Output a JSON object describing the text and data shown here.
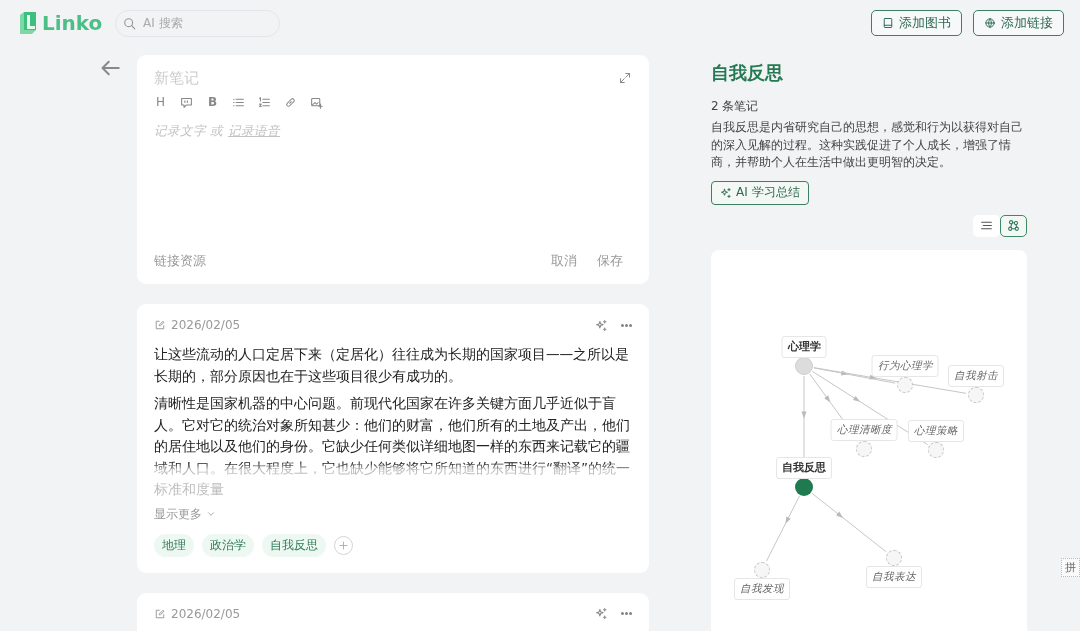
{
  "header": {
    "logo": "Linko",
    "search": {
      "placeholder": "AI 搜索"
    },
    "buttons": [
      {
        "kind": "book",
        "label": "添加图书"
      },
      {
        "kind": "globe",
        "label": "添加链接"
      }
    ]
  },
  "editor": {
    "title_placeholder": "新笔记",
    "toolbar": [
      {
        "kind": "heading",
        "label": "H"
      },
      {
        "kind": "quote"
      },
      {
        "kind": "bold",
        "label": "B"
      },
      {
        "kind": "bullets"
      },
      {
        "kind": "numbers"
      },
      {
        "kind": "link"
      },
      {
        "kind": "image"
      }
    ],
    "placeholder": {
      "text": "记录文字 或",
      "link": "记录语音"
    },
    "link_resource": "链接资源",
    "actions": [
      "取消",
      "保存"
    ]
  },
  "notes": [
    {
      "date": "2026/02/05",
      "paragraphs": [
        "让这些流动的人口定居下来（定居化）往往成为长期的国家项目——之所以是长期的，部分原因也在于这些项目很少有成功的。",
        "清晰性是国家机器的中心问题。前现代化国家在许多关键方面几乎近似于盲人。它对它的统治对象所知甚少：他们的财富，他们所有的土地及产出，他们的居住地以及他们的身份。它缺少任何类似详细地图一样的东西来记载它的疆域和人口。在很大程度上，它也缺少能够将它所知道的东西进行“翻译”的统一标准和度量"
      ],
      "show_more": "显示更多",
      "tags": [
        "地理",
        "政治学",
        "自我反思"
      ]
    },
    {
      "date": "2026/02/05"
    }
  ],
  "topic": {
    "title": "自我反思",
    "count": "2 条笔记",
    "description": "自我反思是内省研究自己的思想，感觉和行为以获得对自己的深入见解的过程。这种实践促进了个人成长，增强了情商，并帮助个人在生活中做出更明智的决定。",
    "ai_button": "AI 学习总结",
    "views": [
      {
        "kind": "list",
        "selected": false
      },
      {
        "kind": "graph",
        "selected": true
      }
    ],
    "graph": {
      "label": "心理学",
      "kind": "topic",
      "children": [
        {
          "label": "行为心理学",
          "kind": "suggested"
        },
        {
          "label": "自我射击",
          "kind": "suggested"
        },
        {
          "label": "心理清晰度",
          "kind": "suggested"
        },
        {
          "label": "心理策略",
          "kind": "suggested"
        },
        {
          "label": "自我反思",
          "kind": "current",
          "children": [
            {
              "label": "自我发现",
              "kind": "suggested"
            },
            {
              "label": "自我表达",
              "kind": "suggested"
            }
          ]
        }
      ]
    }
  },
  "ime_indicator": "拼"
}
